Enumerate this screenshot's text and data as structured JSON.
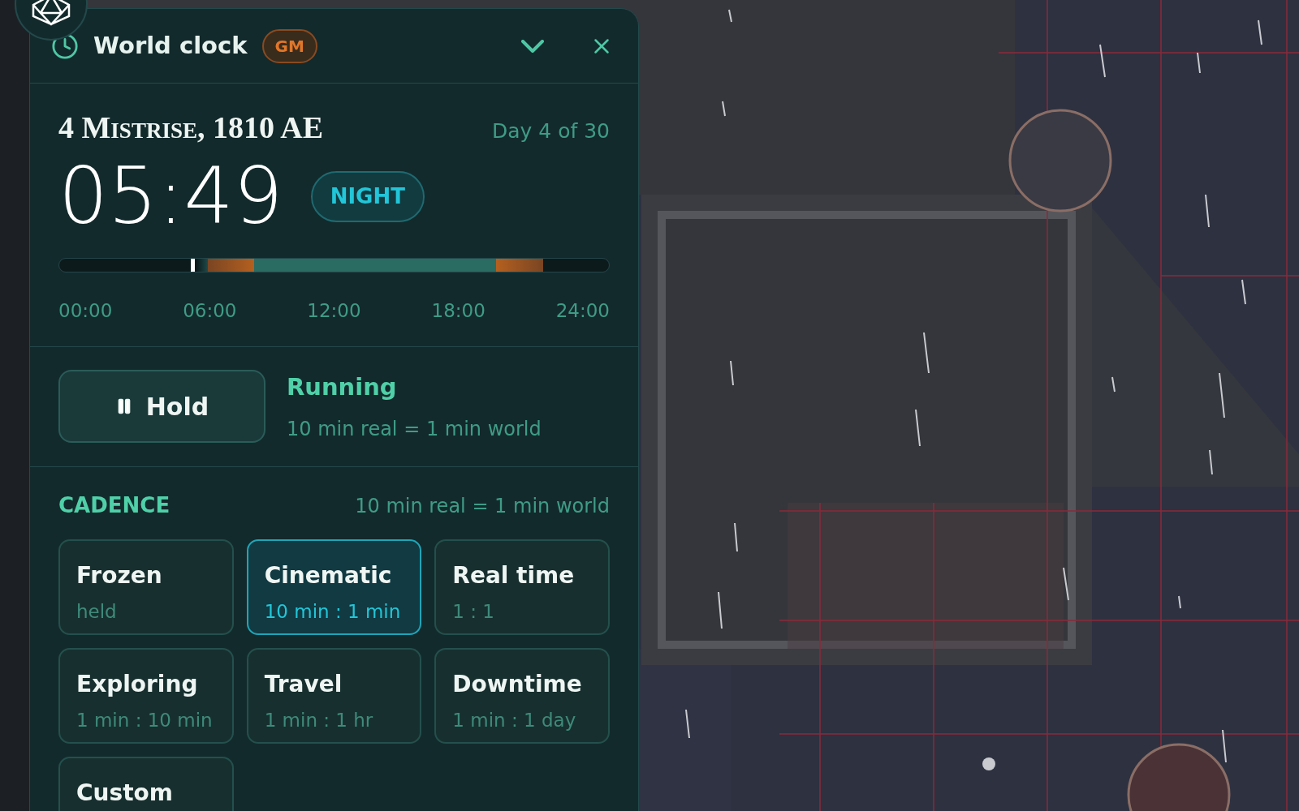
{
  "panel": {
    "title": "World clock",
    "badge": "GM",
    "expanded": true
  },
  "date": {
    "label": "4 Mistrise, 1810 AE",
    "day": "Day 4 of 30"
  },
  "time": {
    "value": "05:49",
    "phase": "NIGHT"
  },
  "timeline": {
    "level": 0.2424,
    "ticks": [
      "00:00",
      "06:00",
      "12:00",
      "18:00",
      "24:00"
    ]
  },
  "status": {
    "button": "Hold",
    "running": true,
    "state": "Running",
    "rate": "10 min real = 1 min world"
  },
  "cadence": {
    "heading": "CADENCE",
    "rate": "10 min real = 1 min world",
    "options": [
      {
        "name": "Frozen",
        "ratio": "held",
        "selected": false
      },
      {
        "name": "Cinematic",
        "ratio": "10 min : 1 min",
        "selected": true
      },
      {
        "name": "Real time",
        "ratio": "1 : 1",
        "selected": false
      },
      {
        "name": "Exploring",
        "ratio": "1 min : 10 min",
        "selected": false
      },
      {
        "name": "Travel",
        "ratio": "1 min : 1 hr",
        "selected": false
      },
      {
        "name": "Downtime",
        "ratio": "1 min : 1 day",
        "selected": false
      },
      {
        "name": "Custom",
        "selected": false
      }
    ]
  }
}
